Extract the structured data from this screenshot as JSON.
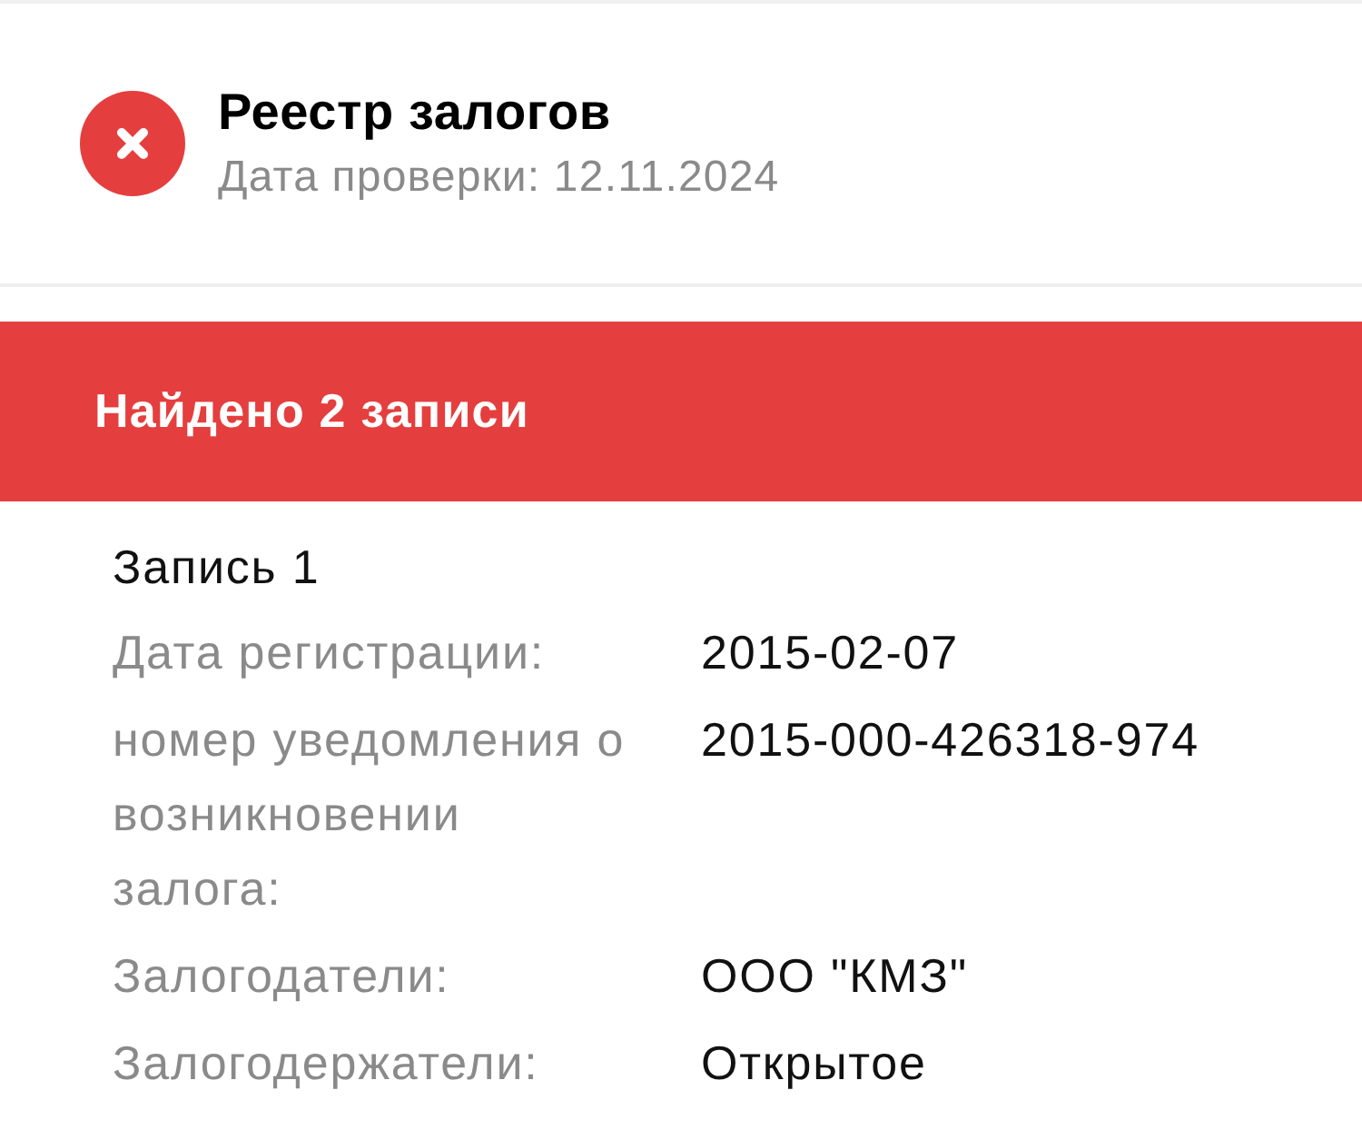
{
  "header": {
    "passed": false,
    "title": "Реестр залогов",
    "subtitle": "Дата проверки: 12.11.2024"
  },
  "banner": {
    "text": "Найдено 2 записи"
  },
  "record": {
    "title": "Запись 1",
    "fields": [
      {
        "label": "Дата регистрации:",
        "value": "2015-02-07"
      },
      {
        "label": "номер уведомления о возникновении залога:",
        "value": "2015-000-426318-974"
      },
      {
        "label": "Залогодатели:",
        "value": "ООО \"КМЗ\""
      },
      {
        "label": "Залогодержатели:",
        "value": "Открытое"
      }
    ]
  }
}
